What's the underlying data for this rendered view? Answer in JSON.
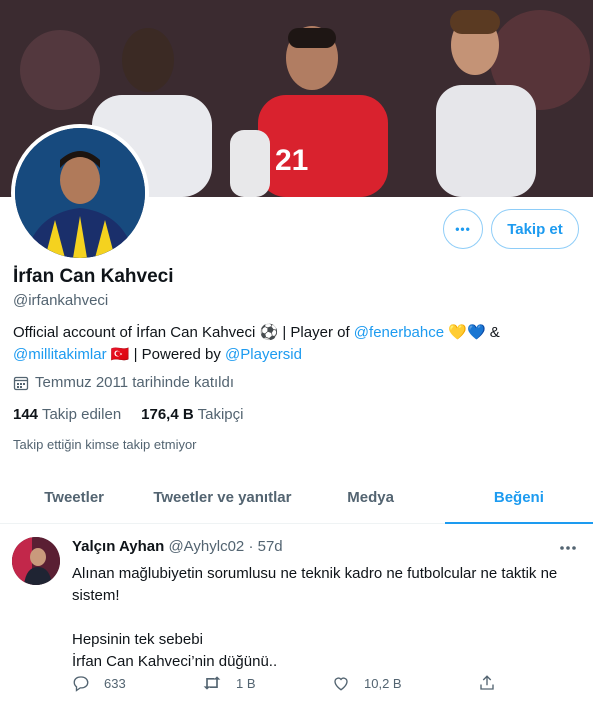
{
  "profile": {
    "name": "İrfan Can Kahveci",
    "handle": "@irfankahveci",
    "bio_line1_start": "Official account of İrfan Can Kahveci ⚽ | Player of ",
    "bio_link1": "@fenerbahce",
    "bio_line1_end": " 💛💙 &",
    "bio_link2": "@millitakimlar",
    "bio_line2_mid": " 🇹🇷 | Powered by ",
    "bio_link3": "@Playersid",
    "joined": "Temmuz 2011 tarihinde katıldı",
    "following_count": "144",
    "following_label": "Takip edilen",
    "followers_count": "176,4 B",
    "followers_label": "Takipçi",
    "followed_by": "Takip ettiğin kimse takip etmiyor"
  },
  "buttons": {
    "more": "•••",
    "follow": "Takip et"
  },
  "tabs": [
    {
      "label": "Tweetler"
    },
    {
      "label": "Tweetler ve yanıtlar"
    },
    {
      "label": "Medya"
    },
    {
      "label": "Beğeni"
    }
  ],
  "tweet": {
    "author_name": "Yalçın Ayhan",
    "author_handle": "@Ayhylc02",
    "time": "· 57d",
    "text": "Alınan mağlubiyetin sorumlusu ne teknik kadro ne futbolcular ne taktik ne sistem!\n\nHepsinin tek sebebi\n İrfan Can Kahveci’nin düğünü..",
    "replies": "633",
    "retweets": "1 B",
    "likes": "10,2 B"
  },
  "colors": {
    "accent": "#1d9bf0",
    "secondary_text": "#536471"
  }
}
